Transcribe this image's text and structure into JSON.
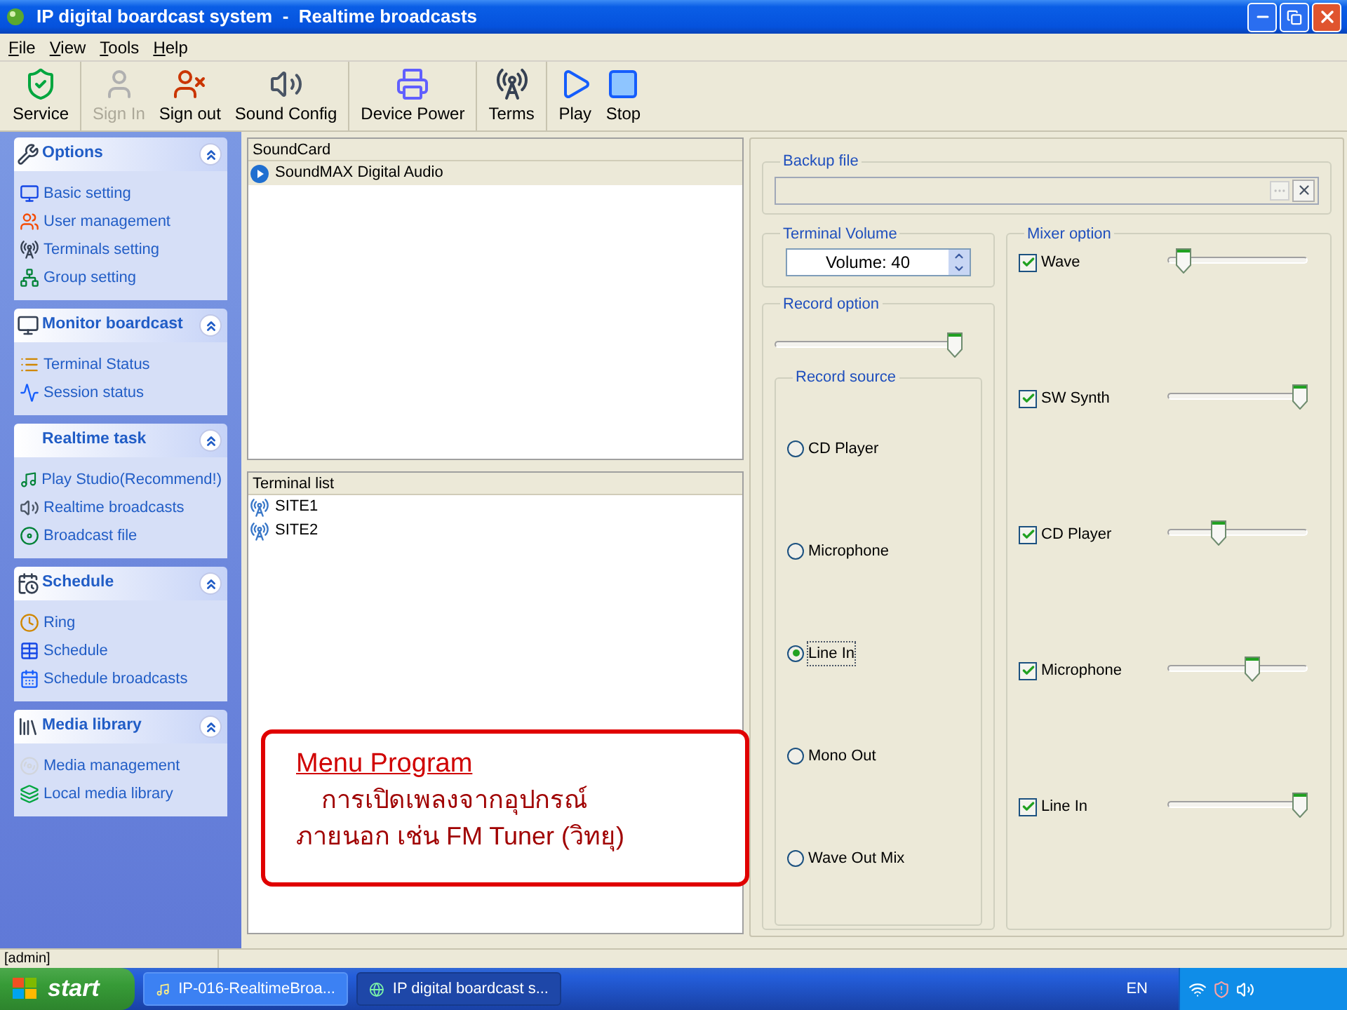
{
  "window": {
    "title": "IP digital boardcast system  -  Realtime broadcasts"
  },
  "menu": [
    "File",
    "View",
    "Tools",
    "Help"
  ],
  "toolbar": [
    [
      {
        "label": "Service",
        "disabled": false
      }
    ],
    [
      {
        "label": "Sign In",
        "disabled": true
      },
      {
        "label": "Sign out",
        "disabled": false
      },
      {
        "label": "Sound Config",
        "disabled": false
      }
    ],
    [
      {
        "label": "Device Power",
        "disabled": false
      }
    ],
    [
      {
        "label": "Terms",
        "disabled": false
      }
    ],
    [
      {
        "label": "Play",
        "disabled": false
      },
      {
        "label": "Stop",
        "disabled": false
      }
    ]
  ],
  "sidebar": [
    {
      "title": "Options",
      "expanded": true,
      "items": [
        "Basic setting",
        "User management",
        "Terminals setting",
        "Group setting"
      ]
    },
    {
      "title": "Monitor boardcast",
      "expanded": true,
      "items": [
        "Terminal Status",
        "Session status"
      ]
    },
    {
      "title": "Realtime task",
      "expanded": true,
      "items": [
        "Play Studio(Recommend!)",
        "Realtime broadcasts",
        "Broadcast file"
      ]
    },
    {
      "title": "Schedule",
      "expanded": true,
      "items": [
        "Ring",
        "Schedule",
        "Schedule broadcasts"
      ]
    },
    {
      "title": "Media library",
      "expanded": true,
      "items": [
        "Media management",
        "Local media library"
      ]
    }
  ],
  "soundcard": {
    "header": "SoundCard",
    "items": [
      {
        "label": "SoundMAX Digital Audio",
        "selected": true
      }
    ]
  },
  "terminal_list": {
    "header": "Terminal list",
    "items": [
      {
        "label": "SITE1",
        "selected": false
      },
      {
        "label": "SITE2",
        "selected": false
      }
    ]
  },
  "backup_file": {
    "label": "Backup file"
  },
  "terminal_volume": {
    "label": "Terminal Volume",
    "value": "Volume: 40"
  },
  "record_option": {
    "label": "Record option",
    "level": 1.0
  },
  "record_source": {
    "label": "Record source",
    "options": [
      {
        "label": "CD Player",
        "selected": false
      },
      {
        "label": "Microphone",
        "selected": false
      },
      {
        "label": "Line In",
        "selected": true
      },
      {
        "label": "Mono Out",
        "selected": false
      },
      {
        "label": "Wave Out Mix",
        "selected": false
      }
    ]
  },
  "mixer_option": {
    "label": "Mixer option",
    "items": [
      {
        "label": "Wave",
        "checked": true,
        "level": 0.07
      },
      {
        "label": "SW Synth",
        "checked": true,
        "level": 1.0
      },
      {
        "label": "CD Player",
        "checked": true,
        "level": 0.35
      },
      {
        "label": "Microphone",
        "checked": true,
        "level": 0.62
      },
      {
        "label": "Line In",
        "checked": true,
        "level": 1.0
      }
    ]
  },
  "status_bar": "[admin]",
  "taskbar": {
    "start": "start",
    "tasks": [
      {
        "label": "IP-016-RealtimeBroa...",
        "selected": false
      },
      {
        "label": "IP digital boardcast s...",
        "selected": true
      }
    ],
    "language": "EN"
  },
  "callout": {
    "title": "Menu Program",
    "lines": [
      "การเปิดเพลงจากอุปกรณ์",
      "ภายนอก เช่น FM Tuner (วิทยุ)"
    ]
  }
}
